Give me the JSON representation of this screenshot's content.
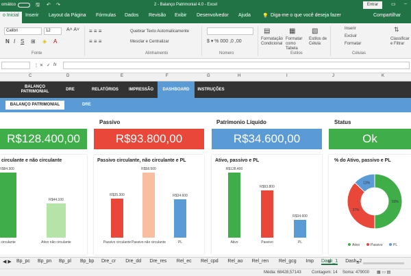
{
  "titlebar": {
    "autosave": "omático",
    "title": "2 - Balanço Patrimonial 4.0  -  Excel",
    "signin": "Entrar"
  },
  "ribbon_tabs": [
    "o Inicial",
    "Inserir",
    "Layout da Página",
    "Fórmulas",
    "Dados",
    "Revisão",
    "Exibir",
    "Desenvolvedor",
    "Ajuda"
  ],
  "tell_me": "Diga-me o que você deseja fazer",
  "share": "Compartilhar",
  "ribbon": {
    "font_name": "Calibri",
    "font_size": "12",
    "wrap_text": "Quebrar Texto Automaticamente",
    "merge_center": "Mesclar e Centralizar",
    "cond_format": "Formatação Condicional",
    "format_table": "Formatar como Tabela",
    "cell_styles": "Estilos de Célula",
    "insert": "Inserir",
    "delete": "Excluir",
    "format": "Formatar",
    "sort_filter": "Classificar e Filtrar",
    "groups": {
      "font": "Fonte",
      "alignment": "Alinhamento",
      "number": "Número",
      "styles": "Estilos",
      "cells": "Células"
    }
  },
  "formula": {
    "cell_ref": "",
    "fx": "fx",
    "value": ""
  },
  "columns": [
    "C",
    "D",
    "E",
    "F",
    "G",
    "H",
    "I",
    "J",
    "K"
  ],
  "nav": {
    "items": [
      "BALANÇO PATRIMONIAL",
      "DRE",
      "RELATÓRIOS",
      "IMPRESSÃO",
      "DASHBOARD",
      "INSTRUÇÕES"
    ],
    "sub": [
      "BALANÇO PATRIMONIAL",
      "DRE"
    ]
  },
  "kpis": [
    {
      "title": "",
      "value": "R$128.400,00",
      "color": "#3fae49"
    },
    {
      "title": "Passivo",
      "value": "R$93.800,00",
      "color": "#e8473a"
    },
    {
      "title": "Patrimonio Líquido",
      "value": "R$34.600,00",
      "color": "#5b9bd5"
    },
    {
      "title": "Status",
      "value": "Ok",
      "color": "#3fae49"
    }
  ],
  "charts": {
    "c1_title": "circulante e não circulante",
    "c2_title": "Passivo circulante, não circulante e PL",
    "c3_title": "Ativo, passivo e PL",
    "c4_title": "% do Ativo, passivo e PL"
  },
  "chart_data": [
    {
      "type": "bar",
      "title": "circulante e não circulante",
      "categories": [
        "o circulante",
        "Ativo não circulante"
      ],
      "values": [
        84300,
        44100
      ],
      "labels": [
        "R$84.300",
        "R$44.100"
      ],
      "colors": [
        "#3fae49",
        "#b6e3a8"
      ]
    },
    {
      "type": "bar",
      "title": "Passivo circulante, não circulante e PL",
      "categories": [
        "Passivo circulante",
        "Passivo não circulante",
        "PL"
      ],
      "values": [
        35300,
        58500,
        34600
      ],
      "labels": [
        "R$35.300",
        "R$58.500",
        "R$34.600"
      ],
      "colors": [
        "#e8473a",
        "#f7bfa0",
        "#5b9bd5"
      ]
    },
    {
      "type": "bar",
      "title": "Ativo, passivo e PL",
      "categories": [
        "Ativo",
        "Passivo",
        "PL"
      ],
      "values": [
        128400,
        93800,
        34600
      ],
      "labels": [
        "R$128.400",
        "R$93.800",
        "R$34.600"
      ],
      "colors": [
        "#3fae49",
        "#e8473a",
        "#5b9bd5"
      ]
    },
    {
      "type": "pie",
      "title": "% do Ativo, passivo e PL",
      "slices": [
        {
          "name": "Ativo",
          "value": 50,
          "label": "50%",
          "color": "#3fae49"
        },
        {
          "name": "Passivo",
          "value": 37,
          "label": "37%",
          "color": "#e8473a"
        },
        {
          "name": "PL",
          "value": 13,
          "label": "13%",
          "color": "#5b9bd5"
        }
      ],
      "legend": "bottom"
    }
  ],
  "sheet_tabs": [
    "Bp_pc",
    "Bp_pn",
    "Bp_pl",
    "Bp_bp",
    "Dre_cr",
    "Dre_dd",
    "Dre_res",
    "Rel_ec",
    "Rel_cpd",
    "Rel_ao",
    "Rel_ren",
    "Rel_gcg",
    "Imp",
    "Dash_1",
    "Dash_2"
  ],
  "active_sheet": "Dash_1",
  "status": {
    "media": "Média: 68428,57143",
    "contagem": "Contagem: 14",
    "soma": "Soma: 479000"
  }
}
